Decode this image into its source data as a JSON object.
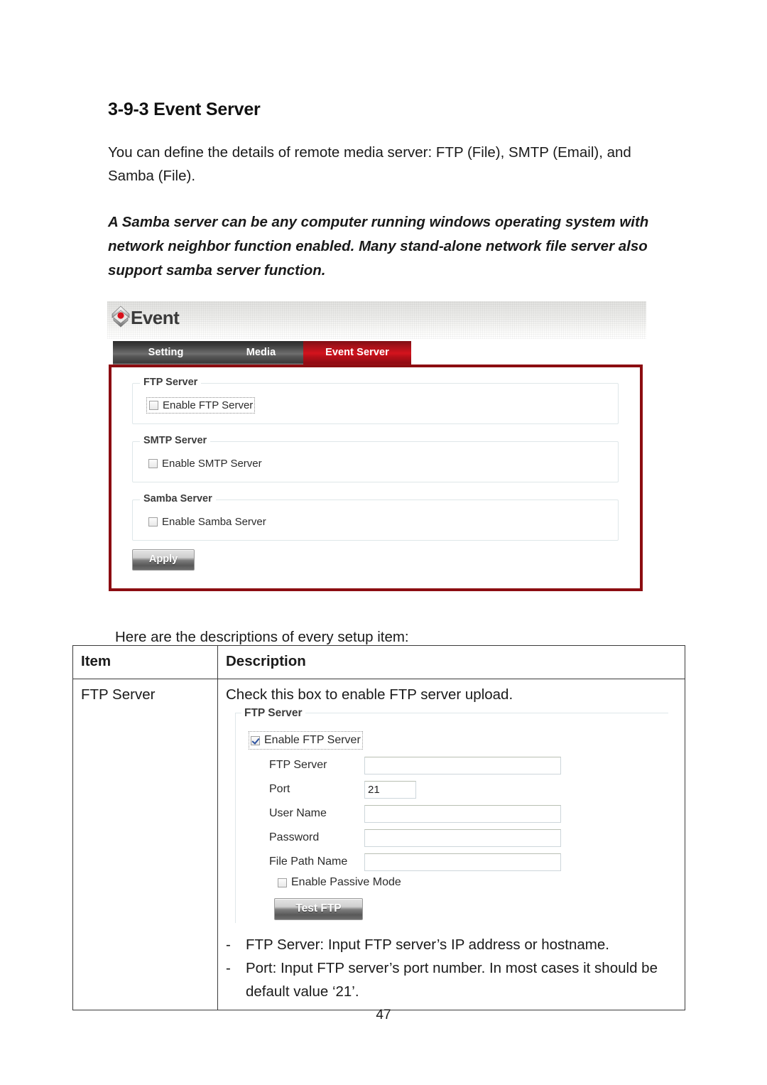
{
  "document": {
    "heading": "3-9-3 Event Server",
    "intro_paragraph": "You can define the details of remote media server: FTP (File), SMTP (Email), and Samba (File).",
    "note_paragraph": "A Samba server can be any computer running windows operating system with network neighbor function enabled. Many stand-alone network file server also support samba server function.",
    "setup_line": "Here are the descriptions of every setup item:",
    "page_number": "47"
  },
  "screenshot": {
    "app_title": "Event",
    "tabs": [
      {
        "label": "Setting",
        "active": false
      },
      {
        "label": "Media",
        "active": false
      },
      {
        "label": "Event Server",
        "active": true
      }
    ],
    "sections": [
      {
        "legend": "FTP Server",
        "checkbox_label": "Enable FTP Server",
        "checked": false
      },
      {
        "legend": "SMTP Server",
        "checkbox_label": "Enable SMTP Server",
        "checked": false
      },
      {
        "legend": "Samba Server",
        "checkbox_label": "Enable Samba Server",
        "checked": false
      }
    ],
    "apply_label": "Apply",
    "colors": {
      "active_tab": "#c2121a",
      "panel_border": "#8c0d11",
      "tab_bar": "#3d3d3d"
    }
  },
  "table": {
    "headers": {
      "item": "Item",
      "description": "Description"
    },
    "row": {
      "item": "FTP Server",
      "description_line": "Check this box to enable FTP server upload.",
      "bullets": [
        {
          "dash": "-",
          "text": "FTP Server: Input FTP server’s IP address or hostname."
        },
        {
          "dash": "-",
          "text": "Port: Input FTP server’s port number. In most cases it should be default value ‘21’."
        }
      ]
    }
  },
  "ftp_form": {
    "legend": "FTP Server",
    "enable_label": "Enable FTP Server",
    "enable_checked": true,
    "fields": [
      {
        "label": "FTP Server",
        "value": ""
      },
      {
        "label": "Port",
        "value": "21"
      },
      {
        "label": "User Name",
        "value": ""
      },
      {
        "label": "Password",
        "value": ""
      },
      {
        "label": "File Path Name",
        "value": ""
      }
    ],
    "passive_label": "Enable Passive Mode",
    "passive_checked": false,
    "test_button_label": "Test FTP"
  }
}
